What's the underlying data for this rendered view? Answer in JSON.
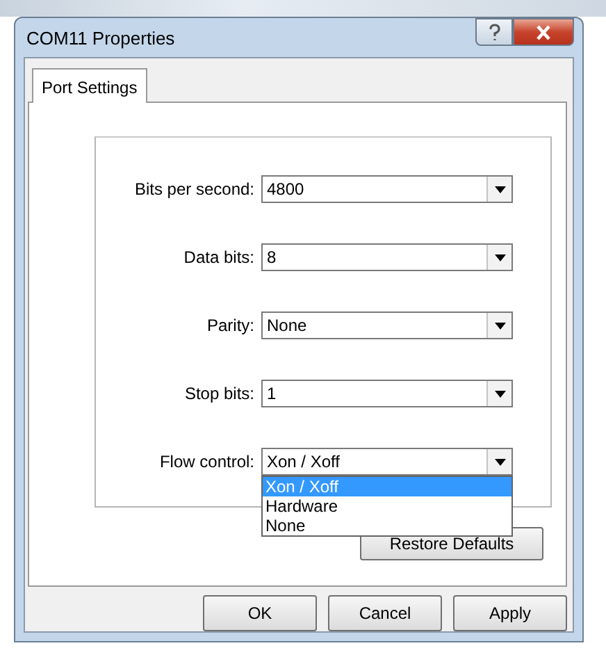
{
  "window": {
    "title": "COM11 Properties"
  },
  "tabs": [
    {
      "label": "Port Settings",
      "selected": true
    }
  ],
  "fields": [
    {
      "label": "Bits per second:",
      "value": "4800"
    },
    {
      "label": "Data bits:",
      "value": "8"
    },
    {
      "label": "Parity:",
      "value": "None"
    },
    {
      "label": "Stop bits:",
      "value": "1"
    },
    {
      "label": "Flow control:",
      "value": "Xon / Xoff",
      "open": true,
      "options": [
        {
          "label": "Xon / Xoff",
          "selected": true
        },
        {
          "label": "Hardware",
          "selected": false
        },
        {
          "label": "None",
          "selected": false
        }
      ]
    }
  ],
  "restore_button": "Restore Defaults",
  "buttons": [
    "OK",
    "Cancel",
    "Apply"
  ]
}
